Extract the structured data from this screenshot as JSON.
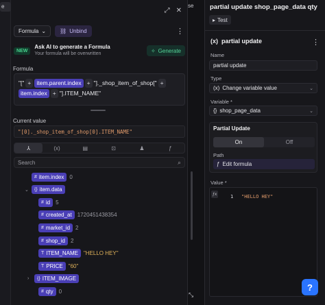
{
  "left_strip": {
    "tag": "e"
  },
  "top_fragment": "se",
  "formula_panel": {
    "mode_label": "Formula",
    "unbind_label": "Unbind",
    "ai": {
      "badge": "NEW",
      "title": "Ask AI to generate a Formula",
      "subtitle": "Your formula will be overwritten",
      "button": "Generate"
    },
    "formula_label": "Formula",
    "formula_tokens": [
      {
        "kind": "text",
        "text": "\"[\""
      },
      {
        "kind": "op",
        "text": "+"
      },
      {
        "kind": "var",
        "text": "item.parent.index"
      },
      {
        "kind": "op",
        "text": "+"
      },
      {
        "kind": "text",
        "text": "\"]._shop_item_of_shop[\""
      },
      {
        "kind": "op",
        "text": "+"
      },
      {
        "kind": "var",
        "text": "item.index"
      },
      {
        "kind": "op",
        "text": "+"
      },
      {
        "kind": "text",
        "text": "\"].ITEM_NAME\""
      }
    ],
    "current_value_label": "Current value",
    "current_value": "\"[0]._shop_item_of_shop[0].ITEM_NAME\"",
    "tabs": [
      "⅄",
      "(x)",
      "▤",
      "⊡",
      "♟",
      "ƒ"
    ],
    "search_placeholder": "Search",
    "tree": [
      {
        "name": "item.index",
        "type": "#",
        "value": "0",
        "vkind": "num",
        "indent": 0,
        "caret": ""
      },
      {
        "name": "item.data",
        "type": "{}",
        "value": "",
        "vkind": "",
        "indent": 0,
        "caret": "⌄"
      },
      {
        "name": "id",
        "type": "#",
        "value": "5",
        "vkind": "num",
        "indent": 1,
        "caret": ""
      },
      {
        "name": "created_at",
        "type": "#",
        "value": "1720451438354",
        "vkind": "num",
        "indent": 1,
        "caret": ""
      },
      {
        "name": "market_id",
        "type": "#",
        "value": "2",
        "vkind": "num",
        "indent": 1,
        "caret": ""
      },
      {
        "name": "shop_id",
        "type": "#",
        "value": "2",
        "vkind": "num",
        "indent": 1,
        "caret": ""
      },
      {
        "name": "ITEM_NAME",
        "type": "T",
        "value": "\"HELLO HEY\"",
        "vkind": "str",
        "indent": 1,
        "caret": ""
      },
      {
        "name": "PRICE",
        "type": "T",
        "value": "\"60\"",
        "vkind": "str",
        "indent": 1,
        "caret": ""
      },
      {
        "name": "ITEM_IMAGE",
        "type": "{}",
        "value": "",
        "vkind": "",
        "indent": 1,
        "caret": "›"
      },
      {
        "name": "qty",
        "type": "#",
        "value": "0",
        "vkind": "num",
        "indent": 1,
        "caret": ""
      }
    ]
  },
  "right_panel": {
    "title": "partial update shop_page_data qty",
    "test_label": "Test",
    "step_title": "partial update",
    "name_label": "Name",
    "name_value": "partial update",
    "type_label": "Type",
    "type_value": "Change variable value",
    "variable_label": "Variable *",
    "variable_value": "shop_page_data",
    "partial_update_title": "Partial Update",
    "toggle_on": "On",
    "toggle_off": "Off",
    "path_label": "Path",
    "edit_formula_label": "Edit formula",
    "value_label": "Value *",
    "value_line_number": "1",
    "value_code": "\"HELLO HEY\""
  },
  "help_glyph": "?"
}
